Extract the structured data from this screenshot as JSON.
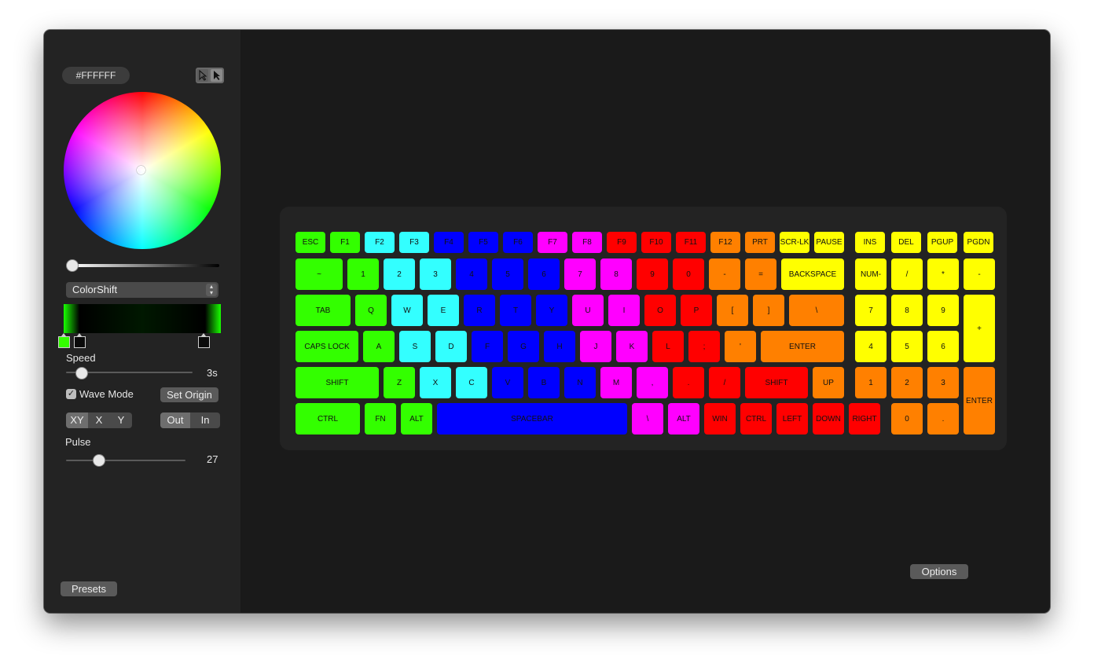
{
  "sidebar": {
    "hex_value": "#FFFFFF",
    "effect_select": "ColorShift",
    "speed": {
      "label": "Speed",
      "value": "3s"
    },
    "wave_mode": {
      "label": "Wave Mode",
      "checked": true
    },
    "set_origin_label": "Set Origin",
    "axis_segment": [
      "XY",
      "X",
      "Y"
    ],
    "direction_segment": [
      "Out",
      "In"
    ],
    "pulse": {
      "label": "Pulse",
      "value": "27"
    },
    "presets_label": "Presets"
  },
  "options_label": "Options",
  "colors": {
    "green": "#33ff00",
    "cyan": "#33ffff",
    "blue": "#0000ff",
    "magenta": "#ff00ff",
    "red": "#ff0000",
    "orange": "#ff8000",
    "yellow": "#ffff00"
  },
  "keyboard": {
    "keys": [
      {
        "label": "ESC",
        "color": "green"
      },
      {
        "label": "F1",
        "color": "green"
      },
      {
        "label": "F2",
        "color": "cyan"
      },
      {
        "label": "F3",
        "color": "cyan"
      },
      {
        "label": "F4",
        "color": "blue"
      },
      {
        "label": "F5",
        "color": "blue"
      },
      {
        "label": "F6",
        "color": "blue"
      },
      {
        "label": "F7",
        "color": "magenta"
      },
      {
        "label": "F8",
        "color": "magenta"
      },
      {
        "label": "F9",
        "color": "red"
      },
      {
        "label": "F10",
        "color": "red"
      },
      {
        "label": "F11",
        "color": "red"
      },
      {
        "label": "F12",
        "color": "orange"
      },
      {
        "label": "PRT",
        "color": "orange"
      },
      {
        "label": "SCR-LK",
        "color": "yellow"
      },
      {
        "label": "PAUSE",
        "color": "yellow"
      },
      {
        "label": "INS",
        "color": "yellow"
      },
      {
        "label": "DEL",
        "color": "yellow"
      },
      {
        "label": "PGUP",
        "color": "yellow"
      },
      {
        "label": "PGDN",
        "color": "yellow"
      },
      {
        "label": "~",
        "color": "green"
      },
      {
        "label": "1",
        "color": "green"
      },
      {
        "label": "2",
        "color": "cyan"
      },
      {
        "label": "3",
        "color": "cyan"
      },
      {
        "label": "4",
        "color": "blue"
      },
      {
        "label": "5",
        "color": "blue"
      },
      {
        "label": "6",
        "color": "blue"
      },
      {
        "label": "7",
        "color": "magenta"
      },
      {
        "label": "8",
        "color": "magenta"
      },
      {
        "label": "9",
        "color": "red"
      },
      {
        "label": "0",
        "color": "red"
      },
      {
        "label": "-",
        "color": "orange"
      },
      {
        "label": "=",
        "color": "orange"
      },
      {
        "label": "BACKSPACE",
        "color": "yellow"
      },
      {
        "label": "NUM-",
        "color": "yellow"
      },
      {
        "label": "/",
        "color": "yellow"
      },
      {
        "label": "*",
        "color": "yellow"
      },
      {
        "label": "-",
        "color": "yellow"
      },
      {
        "label": "TAB",
        "color": "green"
      },
      {
        "label": "Q",
        "color": "green"
      },
      {
        "label": "W",
        "color": "cyan"
      },
      {
        "label": "E",
        "color": "cyan"
      },
      {
        "label": "R",
        "color": "blue"
      },
      {
        "label": "T",
        "color": "blue"
      },
      {
        "label": "Y",
        "color": "blue"
      },
      {
        "label": "U",
        "color": "magenta"
      },
      {
        "label": "I",
        "color": "magenta"
      },
      {
        "label": "O",
        "color": "red"
      },
      {
        "label": "P",
        "color": "red"
      },
      {
        "label": "[",
        "color": "orange"
      },
      {
        "label": "]",
        "color": "orange"
      },
      {
        "label": "\\",
        "color": "orange"
      },
      {
        "label": "7",
        "color": "yellow"
      },
      {
        "label": "8",
        "color": "yellow"
      },
      {
        "label": "9",
        "color": "yellow"
      },
      {
        "label": "+",
        "color": "yellow"
      },
      {
        "label": "CAPS LOCK",
        "color": "green"
      },
      {
        "label": "A",
        "color": "green"
      },
      {
        "label": "S",
        "color": "cyan"
      },
      {
        "label": "D",
        "color": "cyan"
      },
      {
        "label": "F",
        "color": "blue"
      },
      {
        "label": "G",
        "color": "blue"
      },
      {
        "label": "H",
        "color": "blue"
      },
      {
        "label": "J",
        "color": "magenta"
      },
      {
        "label": "K",
        "color": "magenta"
      },
      {
        "label": "L",
        "color": "red"
      },
      {
        "label": ";",
        "color": "red"
      },
      {
        "label": "'",
        "color": "orange"
      },
      {
        "label": "ENTER",
        "color": "orange"
      },
      {
        "label": "4",
        "color": "yellow"
      },
      {
        "label": "5",
        "color": "yellow"
      },
      {
        "label": "6",
        "color": "yellow"
      },
      {
        "label": "SHIFT",
        "color": "green"
      },
      {
        "label": "Z",
        "color": "green"
      },
      {
        "label": "X",
        "color": "cyan"
      },
      {
        "label": "C",
        "color": "cyan"
      },
      {
        "label": "V",
        "color": "blue"
      },
      {
        "label": "B",
        "color": "blue"
      },
      {
        "label": "N",
        "color": "blue"
      },
      {
        "label": "M",
        "color": "magenta"
      },
      {
        "label": ",",
        "color": "magenta"
      },
      {
        "label": ".",
        "color": "red"
      },
      {
        "label": "/",
        "color": "red"
      },
      {
        "label": "SHIFT",
        "color": "red"
      },
      {
        "label": "UP",
        "color": "orange"
      },
      {
        "label": "1",
        "color": "orange"
      },
      {
        "label": "2",
        "color": "orange"
      },
      {
        "label": "3",
        "color": "orange"
      },
      {
        "label": "ENTER",
        "color": "orange"
      },
      {
        "label": "CTRL",
        "color": "green"
      },
      {
        "label": "FN",
        "color": "green"
      },
      {
        "label": "ALT",
        "color": "green"
      },
      {
        "label": "SPACEBAR",
        "color": "blue"
      },
      {
        "label": "\\",
        "color": "magenta"
      },
      {
        "label": "ALT",
        "color": "magenta"
      },
      {
        "label": "WIN",
        "color": "red"
      },
      {
        "label": "CTRL",
        "color": "red"
      },
      {
        "label": "LEFT",
        "color": "red"
      },
      {
        "label": "DOWN",
        "color": "red"
      },
      {
        "label": "RIGHT",
        "color": "red"
      },
      {
        "label": "0",
        "color": "orange"
      },
      {
        "label": ".",
        "color": "orange"
      }
    ]
  }
}
